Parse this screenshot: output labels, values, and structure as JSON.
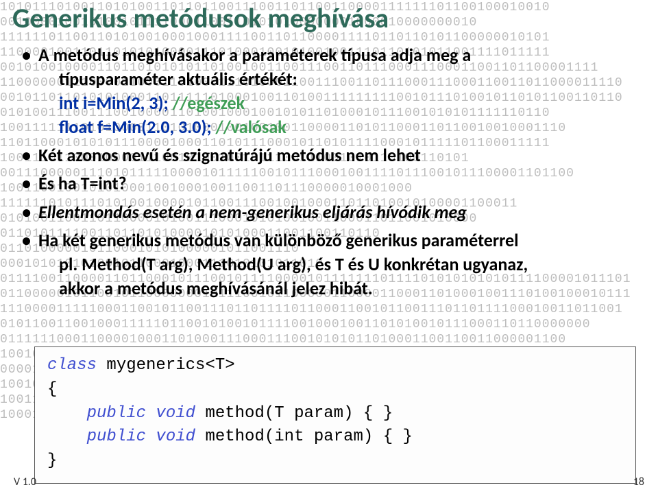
{
  "title": "Generikus metódusok meghívása",
  "bullets": {
    "b1_line1": "A metódus meghívásakor a paraméterek típusa adja meg a",
    "b1_line2": "típusparaméter aktuális értékét:",
    "b1_code1a": "int i=Min(2, 3);    ",
    "b1_code1b": "//egészek",
    "b1_code2a": "float f=Min(2.0, 3.0);  ",
    "b1_code2b": "//valósak",
    "b2": "Két azonos nevű és szignatúrájú metódus nem lehet",
    "b3": "És ha T=int?",
    "b4": "Ellentmondás esetén a nem-generikus eljárás hívódik meg",
    "b5_line1": "Ha két generikus metódus van különböző generikus paraméterrel",
    "b5_line2": "pl. Method(T arg), Method(U arg), és T és U konkrétan ugyanaz,",
    "b5_line3": "akkor a metódus meghívásánál jelez hibát."
  },
  "code": {
    "kw1": "class",
    "l1b": " mygenerics<T>",
    "l2": "{",
    "kw2": "public void",
    "l3b": " method(T param) { }",
    "kw3": "public void",
    "l4b": " method(int param) { }",
    "l5": "}"
  },
  "footer": {
    "left": "V 1.0",
    "right": "18"
  },
  "binary": "10101110100110101001101101100111001101100110000111111101100100010010\n00100001001010010111100011001101010100000001000010000000010\n11111101100110101001000100011110011011000011110110110101100000010101\n11000010011011010101000011101000100101001001110110101011001111011111\n00101001000011011010101011010010011001110011011100011100011001101100001111\n11000000111000011000110100011101000110011100110111000111000110011011000011110\n00101101101010100011011111010001001101001111111110010111010010110101100110110\n01010011100111001000011010010001001010110100010111001010101111110110\n1001111111010100001101010001001001001100001101011000110110010010001110\n11011000101010111000010001101011100010110101111000101111101100011111\n1001110110001000011100101001001011100111001010110100110101\n00111000001110101111100001011111001011100010011110111001011100001101100\n100110010010101000100100010011001101110000010001000\n1111110101110101001000010110011100100100011011010010100001100011\n01010011001101100001010011100010101001001100011011001010000\n01101011110011011010100001010100011001100110110\n0110100000101100010101000001011001110\n0001010101010010110001000111010101011010\n011110011000011011000101110010111100001011111110111101010101010111100001011101\n011000001011001011000000010111001011000001100001100011010001001110100100010111\n11100001111100011001011001110110111101100011001011001110110111100010011011001\n0101100110010001111101100101001011110010001001101010010111000110110000000\n0111111000110000100011010001110001110010101011010001100110011000001100\n1001001001101101010010011010001011010000111100011000011101100110010101100110\n000010000100010001010010100101101101001011010010111010010110100101110100110\n1001010110101010000001000101010000001000101010000001100011001100110\n1001101000110110101010001101010011000110110101010001101010101000110101010011\n100010010011000110110011010111010010001001100011011001101011101001000100110"
}
